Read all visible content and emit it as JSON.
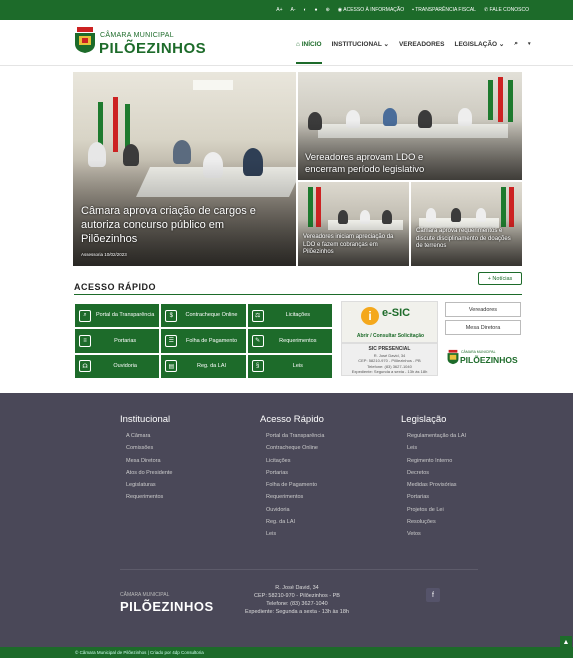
{
  "topbar": {
    "font_plus": "A+",
    "font_minus": "A-",
    "access_info": "ACESSO À INFORMAÇÃO",
    "transparency": "TRANSPARÊNCIA FISCAL",
    "contact": "FALE CONOSCO"
  },
  "header": {
    "logo_small": "CÂMARA MUNICIPAL",
    "logo_big": "PILÕEZINHOS",
    "nav": [
      "INÍCIO",
      "INSTITUCIONAL ⌄",
      "VEREADORES",
      "LEGISLAÇÃO ⌄"
    ]
  },
  "hero": {
    "main_caption": "Câmara aprova criação de cargos e autoriza concurso público em Pilõezinhos",
    "main_meta": "Assessoria   10/02/2023",
    "top_right_caption": "Vereadores aprovam LDO e encerram período legislativo",
    "bottom_left_caption": "Vereadores iniciam apreciação da LDO e fazem cobranças em Pilõezinhos",
    "bottom_right_caption": "Câmara aprova requerimentos e discute disciplinamento de doações de terrenos"
  },
  "quick_access": {
    "title": "ACESSO RÁPIDO",
    "more_news": "+ Notícias",
    "items": [
      {
        "label": "Portal da Transparência",
        "icon": "search-chart-icon"
      },
      {
        "label": "Contracheque Online",
        "icon": "money-icon"
      },
      {
        "label": "Licitações",
        "icon": "gavel-icon"
      },
      {
        "label": "Portarias",
        "icon": "document-icon"
      },
      {
        "label": "Folha de Pagamento",
        "icon": "payroll-icon"
      },
      {
        "label": "Requerimentos",
        "icon": "form-icon"
      },
      {
        "label": "Ouvidoria",
        "icon": "headset-icon"
      },
      {
        "label": "Reg. da LAI",
        "icon": "register-icon"
      },
      {
        "label": "Leis",
        "icon": "law-icon"
      }
    ],
    "esic_title": "e-SIC",
    "esic_sub": "Abrir / Consultar Solicitação",
    "sic_title": "SIC PRESENCIAL",
    "sic_lines": [
      "R. José David, 34",
      "CEP: 58210-970 - Pilõezinhos - PB",
      "Telefone: (83) 3627-1040",
      "Expediente: Segunda a sexta - 13h às 18h"
    ],
    "side_buttons": [
      "Vereadores",
      "Mesa Diretora"
    ],
    "side_logo_small": "CÂMARA MUNICIPAL",
    "side_logo_big": "PILÕEZINHOS"
  },
  "footer": {
    "columns": [
      {
        "title": "Institucional",
        "links": [
          "A Câmara",
          "Comissões",
          "Mesa Diretora",
          "Atos do Presidente",
          "Legislaturas",
          "Requerimentos"
        ]
      },
      {
        "title": "Acesso Rápido",
        "links": [
          "Portal da Transparência",
          "Contracheque Online",
          "Licitações",
          "Portarias",
          "Folha de Pagamento",
          "Requerimentos",
          "Ouvidoria",
          "Reg. da LAI",
          "Leis"
        ]
      },
      {
        "title": "Legislação",
        "links": [
          "Regulamentação da LAI",
          "Leis",
          "Regimento Interno",
          "Decretos",
          "Medidas Provisórias",
          "Portarias",
          "Projetos de Lei",
          "Resoluções",
          "Vetos"
        ]
      }
    ],
    "logo_small": "CÂMARA MUNICIPAL",
    "logo_big": "PILÕEZINHOS",
    "address": [
      "R. José David, 34",
      "CEP: 58210-970 - Pilõezinhos - PB",
      "Telefone: (83) 3627-1040",
      "Expediente: Segunda a sexta - 13h às 18h"
    ],
    "copyright": "© Câmara Municipal de Pilõezinhos | Criado por 4dp Consultoria"
  },
  "colors": {
    "brand_green": "#1d6b2a",
    "footer_bg": "#4a4858",
    "accent_orange": "#f4a81c"
  }
}
